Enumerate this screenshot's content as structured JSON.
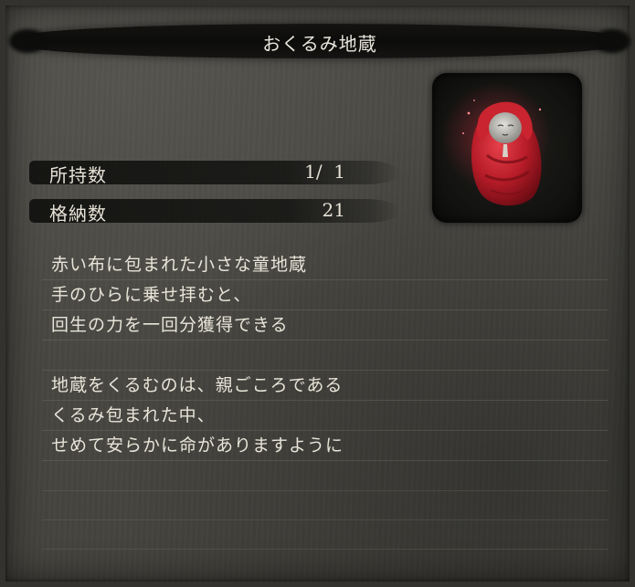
{
  "item": {
    "name": "おくるみ地蔵",
    "image_icon": "swaddled-jizo-icon"
  },
  "stats": [
    {
      "label": "所持数",
      "value": "1/  1"
    },
    {
      "label": "格納数",
      "value": "21"
    }
  ],
  "description": {
    "lines": [
      "赤い布に包まれた小さな童地蔵",
      "手のひらに乗せ拝むと、",
      "回生の力を一回分獲得できる",
      "",
      "地蔵をくるむのは、親ごころである",
      "くるみ包まれた中、",
      "せめて安らかに命がありますように"
    ]
  },
  "colors": {
    "panel_bg": "#4a4944",
    "text": "#e8e4d8",
    "ink_stroke": "#121210",
    "cloth_red": "#c4202c"
  }
}
